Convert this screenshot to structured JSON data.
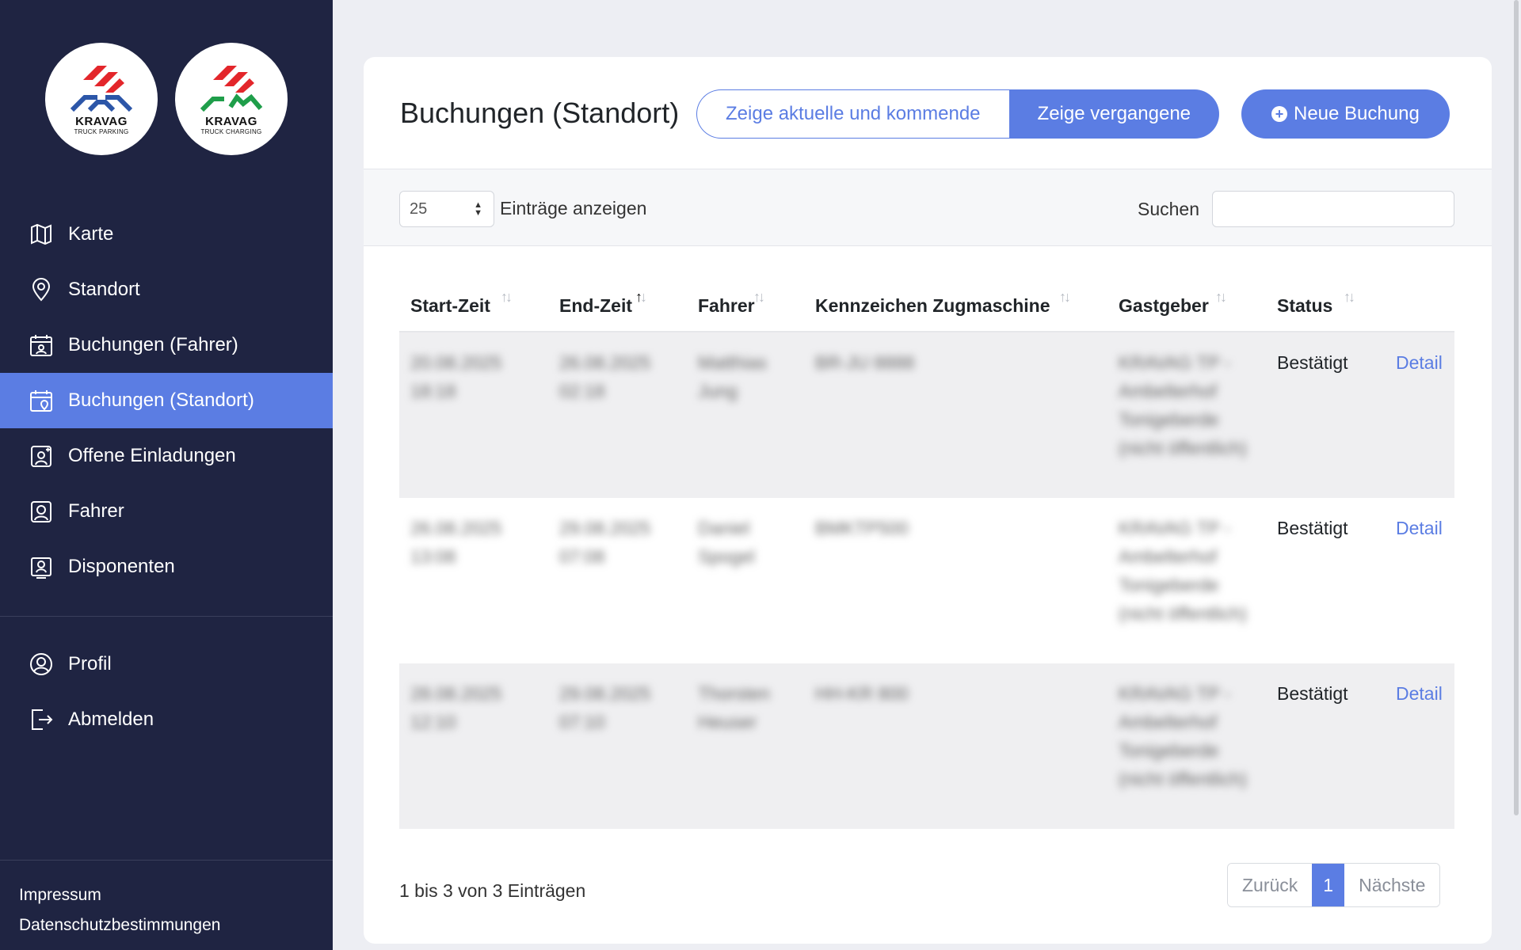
{
  "brand": {
    "logo1_name": "KRAVAG",
    "logo1_sub": "TRUCK PARKING",
    "logo2_name": "KRAVAG",
    "logo2_sub": "TRUCK CHARGING"
  },
  "sidebar": {
    "items": [
      {
        "label": "Karte",
        "icon": "map-icon"
      },
      {
        "label": "Standort",
        "icon": "location-pin-icon"
      },
      {
        "label": "Buchungen (Fahrer)",
        "icon": "calendar-driver-icon"
      },
      {
        "label": "Buchungen (Standort)",
        "icon": "calendar-location-icon",
        "active": true
      },
      {
        "label": "Offene Einladungen",
        "icon": "user-add-icon"
      },
      {
        "label": "Fahrer",
        "icon": "driver-icon"
      },
      {
        "label": "Disponenten",
        "icon": "dispatcher-icon"
      }
    ],
    "items2": [
      {
        "label": "Profil",
        "icon": "profile-icon"
      },
      {
        "label": "Abmelden",
        "icon": "logout-icon"
      }
    ],
    "footer": {
      "imprint": "Impressum",
      "privacy": "Datenschutzbestimmungen"
    }
  },
  "header": {
    "title": "Buchungen (Standort)",
    "btn_current": "Zeige aktuelle und kommende",
    "btn_past": "Zeige vergangene",
    "btn_new": "Neue Buchung"
  },
  "filters": {
    "length_value": "25",
    "length_label": "Einträge anzeigen",
    "search_label": "Suchen",
    "search_value": ""
  },
  "table": {
    "columns": [
      "Start-Zeit",
      "End-Zeit",
      "Fahrer",
      "Kennzeichen Zugmaschine",
      "Gastgeber",
      "Status"
    ],
    "rows": [
      {
        "start": "20.08.2025 18:18",
        "end": "26.08.2025 02:18",
        "driver": "Matthias Jung",
        "plate": "BR-JU 8888",
        "host": "KRAVAG TP - Ambelterhof Tonigeberde (nicht öffentlich)",
        "status": "Bestätigt",
        "action": "Detail"
      },
      {
        "start": "26.08.2025 13:08",
        "end": "29.08.2025 07:08",
        "driver": "Daniel Spogel",
        "plate": "BMKTP500",
        "host": "KRAVAG TP - Ambelterhof Tonigeberde (nicht öffentlich)",
        "status": "Bestätigt",
        "action": "Detail"
      },
      {
        "start": "28.08.2025 12:10",
        "end": "29.08.2025 07:10",
        "driver": "Thorsten Heuser",
        "plate": "HH-KR 800",
        "host": "KRAVAG TP - Ambelterhof Tonigeberde (nicht öffentlich)",
        "status": "Bestätigt",
        "action": "Detail"
      }
    ]
  },
  "footer_info": "1 bis 3 von 3 Einträgen",
  "pager": {
    "prev": "Zurück",
    "current": "1",
    "next": "Nächste"
  },
  "colors": {
    "accent": "#5b7de3",
    "sidebar_bg": "#1f2442",
    "logo_red": "#e3262b",
    "logo_blue": "#2c56a8",
    "logo_green": "#1f9e4a"
  }
}
